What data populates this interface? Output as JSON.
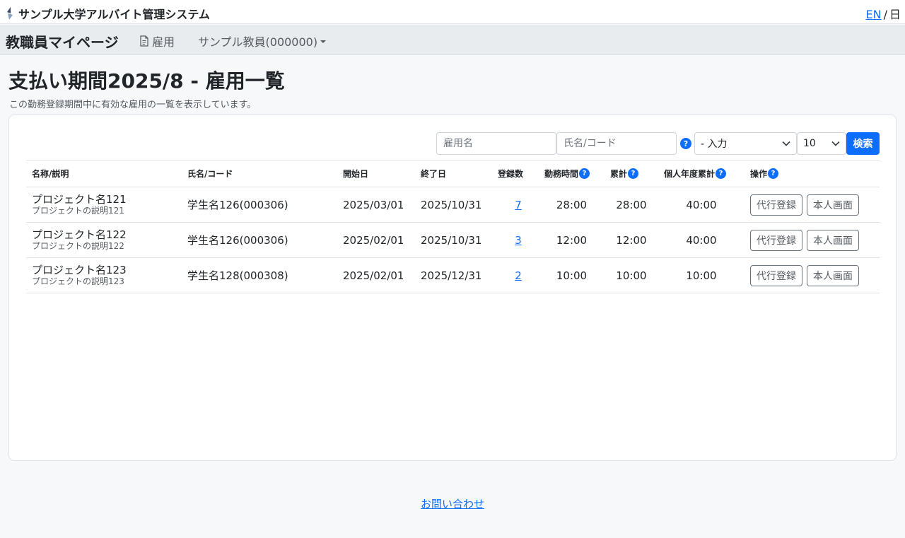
{
  "topbar": {
    "app_title": "サンプル大学アルバイト管理システム",
    "lang_en": "EN",
    "lang_sep": "/",
    "lang_ja": "日"
  },
  "navbar": {
    "brand": "教職員マイページ",
    "employment_label": "雇用",
    "user_label": "サンプル教員(000000)"
  },
  "page": {
    "title": "支払い期間2025/8 - 雇用一覧",
    "subtitle": "この勤務登録期間中に有効な雇用の一覧を表示しています。"
  },
  "filters": {
    "employment_placeholder": "雇用名",
    "name_placeholder": "氏名/コード",
    "help": "?",
    "input_select": "- 入力",
    "count_select": "10",
    "search_label": "検索"
  },
  "table": {
    "headers": {
      "name": "名称/説明",
      "person": "氏名/コード",
      "start": "開始日",
      "end": "終了日",
      "registrations": "登録数",
      "work_hours": "勤務時間",
      "total": "累計",
      "yearly_total": "個人年度累計",
      "actions": "操作"
    },
    "rows": [
      {
        "name": "プロジェクト名121",
        "desc": "プロジェクトの説明121",
        "person": "学生名126(000306)",
        "start": "2025/03/01",
        "end": "2025/10/31",
        "registrations": "7",
        "work_hours": "28:00",
        "total": "28:00",
        "yearly_total": "40:00",
        "proxy_label": "代行登録",
        "self_label": "本人画面"
      },
      {
        "name": "プロジェクト名122",
        "desc": "プロジェクトの説明122",
        "person": "学生名126(000306)",
        "start": "2025/02/01",
        "end": "2025/10/31",
        "registrations": "3",
        "work_hours": "12:00",
        "total": "12:00",
        "yearly_total": "40:00",
        "proxy_label": "代行登録",
        "self_label": "本人画面"
      },
      {
        "name": "プロジェクト名123",
        "desc": "プロジェクトの説明123",
        "person": "学生名128(000308)",
        "start": "2025/02/01",
        "end": "2025/12/31",
        "registrations": "2",
        "work_hours": "10:00",
        "total": "10:00",
        "yearly_total": "10:00",
        "proxy_label": "代行登録",
        "self_label": "本人画面"
      }
    ]
  },
  "footer": {
    "contact_label": "お問い合わせ"
  },
  "colors": {
    "accent": "#0d6efd",
    "navbar_bg": "#e9ecef",
    "page_bg": "#f7f8fa"
  }
}
